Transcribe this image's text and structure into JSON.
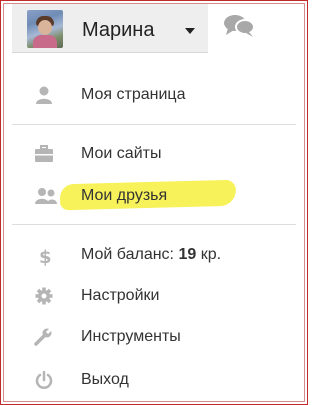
{
  "user": {
    "name": "Марина"
  },
  "menu": {
    "my_page": "Моя страница",
    "my_sites": "Мои сайты",
    "my_friends": "Мои друзья",
    "balance_label": "Мой баланс:",
    "balance_value": "19",
    "balance_unit": "кр.",
    "settings": "Настройки",
    "tools": "Инструменты",
    "logout": "Выход"
  },
  "colors": {
    "highlight": "#f7f25a",
    "icon": "#b5b5b5",
    "header_bg": "#eeeeee",
    "frame": "#c22a2a"
  },
  "icons": [
    "user-icon",
    "briefcase-icon",
    "friends-icon",
    "dollar-icon",
    "gear-icon",
    "wrench-icon",
    "power-icon",
    "chat-icon",
    "caret-down-icon"
  ]
}
